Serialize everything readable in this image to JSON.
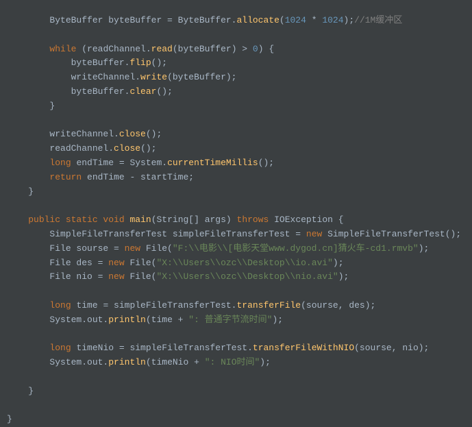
{
  "code": {
    "l1_a": "ByteBuffer byteBuffer = ByteBuffer.",
    "l1_b": "allocate",
    "l1_c": "(",
    "l1_d": "1024",
    "l1_e": " * ",
    "l1_f": "1024",
    "l1_g": ");",
    "l1_h": "//1M缓冲区",
    "l2_a": "while",
    "l2_b": " (readChannel.",
    "l2_c": "read",
    "l2_d": "(byteBuffer) > ",
    "l2_e": "0",
    "l2_f": ") {",
    "l3_a": "byteBuffer.",
    "l3_b": "flip",
    "l3_c": "();",
    "l4_a": "writeChannel.",
    "l4_b": "write",
    "l4_c": "(byteBuffer);",
    "l5_a": "byteBuffer.",
    "l5_b": "clear",
    "l5_c": "();",
    "l6": "}",
    "l7_a": "writeChannel.",
    "l7_b": "close",
    "l7_c": "();",
    "l8_a": "readChannel.",
    "l8_b": "close",
    "l8_c": "();",
    "l9_a": "long",
    "l9_b": " endTime = System.",
    "l9_c": "currentTimeMillis",
    "l9_d": "();",
    "l10_a": "return",
    "l10_b": " endTime - startTime;",
    "l11": "}",
    "l12_a": "public static void",
    "l12_b": " ",
    "l12_c": "main",
    "l12_d": "(String[] args) ",
    "l12_e": "throws",
    "l12_f": " IOException {",
    "l13_a": "SimpleFileTransferTest simpleFileTransferTest = ",
    "l13_b": "new",
    "l13_c": " SimpleFileTransferTest();",
    "l14_a": "File sourse = ",
    "l14_b": "new",
    "l14_c": " File(",
    "l14_d": "\"F:\\\\电影\\\\[电影天堂www.dygod.cn]猜火车-cd1.rmvb\"",
    "l14_e": ");",
    "l15_a": "File des = ",
    "l15_b": "new",
    "l15_c": " File(",
    "l15_d": "\"X:\\\\Users\\\\ozc\\\\Desktop\\\\io.avi\"",
    "l15_e": ");",
    "l16_a": "File nio = ",
    "l16_b": "new",
    "l16_c": " File(",
    "l16_d": "\"X:\\\\Users\\\\ozc\\\\Desktop\\\\nio.avi\"",
    "l16_e": ");",
    "l17_a": "long",
    "l17_b": " time = simpleFileTransferTest.",
    "l17_c": "transferFile",
    "l17_d": "(sourse, des);",
    "l18_a": "System.out.",
    "l18_b": "println",
    "l18_c": "(time + ",
    "l18_d": "\": 普通字节流时间\"",
    "l18_e": ");",
    "l19_a": "long",
    "l19_b": " timeNio = simpleFileTransferTest.",
    "l19_c": "transferFileWithNIO",
    "l19_d": "(sourse, nio);",
    "l20_a": "System.out.",
    "l20_b": "println",
    "l20_c": "(timeNio + ",
    "l20_d": "\": NIO时间\"",
    "l20_e": ");",
    "l21": "}",
    "l22": "}"
  }
}
